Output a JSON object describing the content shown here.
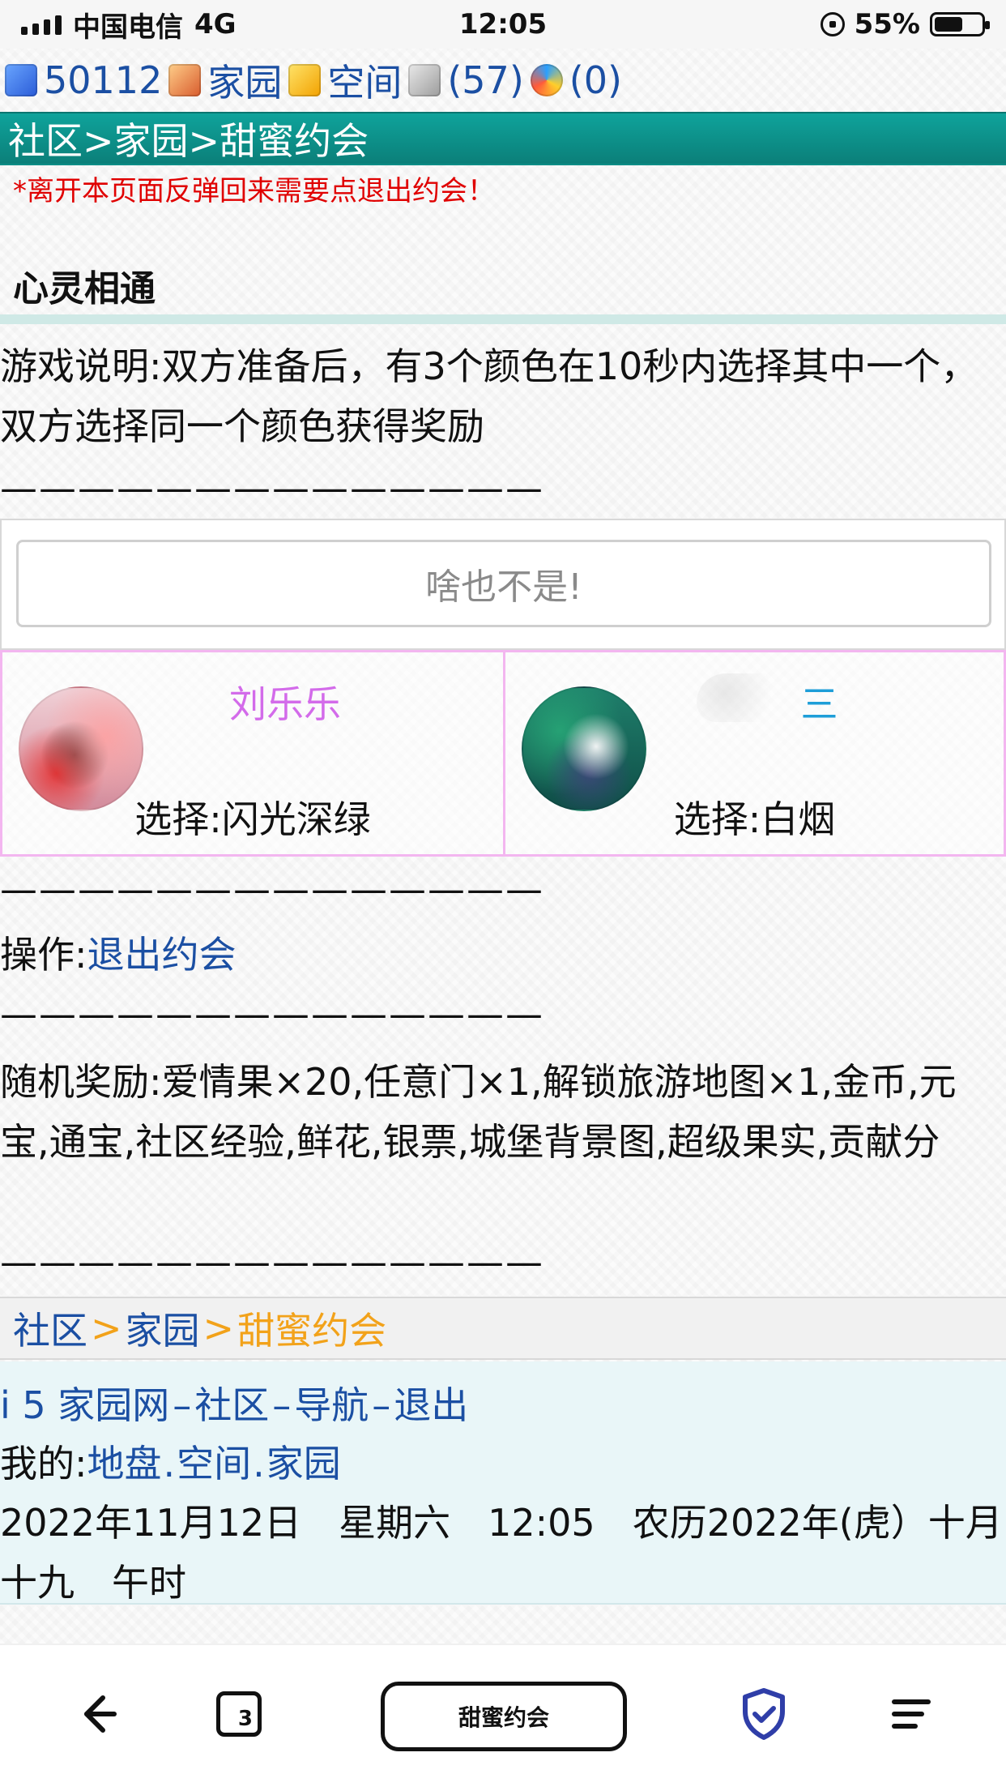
{
  "status_bar": {
    "carrier": "中国电信",
    "network": "4G",
    "time": "12:05",
    "battery": "55%"
  },
  "top_info": {
    "user_id": "50112",
    "home": "家园",
    "space": "空间",
    "bank_count": "(57)",
    "other_count": "(0)"
  },
  "breadcrumb": {
    "text": "社区>家园>甜蜜约会"
  },
  "warning": "*离开本页面反弹回来需要点退出约会！",
  "game": {
    "title": "心灵相通",
    "description": "游戏说明:双方准备后，有3个颜色在10秒内选择其中一个，双方选择同一个颜色获得奖励",
    "separator": "——————————————",
    "result_text": "啥也不是!",
    "players": [
      {
        "name": "刘乐乐",
        "choice": "选择:闪光深绿"
      },
      {
        "name": "三",
        "choice": "选择:白烟"
      }
    ],
    "operation_label": "操作:",
    "operation_link": "退出约会",
    "rewards": "随机奖励:爱情果×20,任意门×1,解锁旅游地图×1,金币,元宝,通宝,社区经验,鲜花,银票,城堡背景图,超级果实,贡献分"
  },
  "footer": {
    "crumb": {
      "community": "社区",
      "home": "家园",
      "date": "甜蜜约会"
    },
    "nav_line": {
      "site": "i 5 家园网",
      "community": "社区",
      "nav": "导航",
      "logout": "退出"
    },
    "my_line": {
      "label": "我的:",
      "land": "地盘",
      "space": "空间",
      "home": "家园"
    },
    "date_line": "2022年11月12日　星期六　12:05　农历2022年(虎）十月十九　午时"
  },
  "bottom_bar": {
    "tab_count": "3",
    "center_title": "甜蜜约会"
  },
  "colors": {
    "teal_bar": "#0b7f79",
    "link": "#1b4fa3",
    "warning": "#e00000",
    "player1_name": "#d36bea",
    "player2_name": "#1e9ed8",
    "accent_orange": "#f2a21a",
    "shield": "#2f3ea8"
  }
}
